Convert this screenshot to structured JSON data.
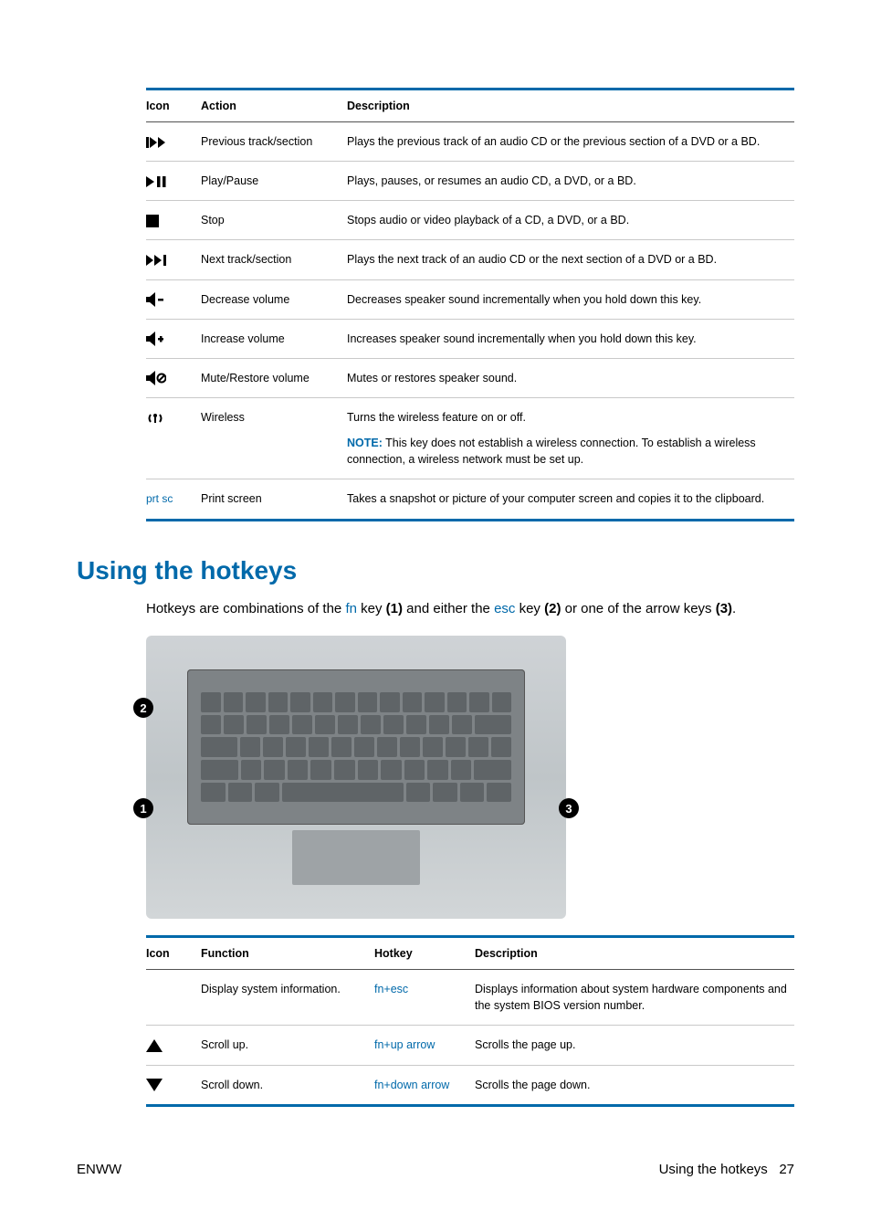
{
  "table1": {
    "headers": {
      "icon": "Icon",
      "action": "Action",
      "desc": "Description"
    },
    "rows": [
      {
        "action": "Previous track/section",
        "desc": "Plays the previous track of an audio CD or the previous section of a DVD or a BD."
      },
      {
        "action": "Play/Pause",
        "desc": "Plays, pauses, or resumes an audio CD, a DVD, or a BD."
      },
      {
        "action": "Stop",
        "desc": "Stops audio or video playback of a CD, a DVD, or a BD."
      },
      {
        "action": "Next track/section",
        "desc": "Plays the next track of an audio CD or the next section of a DVD or a BD."
      },
      {
        "action": "Decrease volume",
        "desc": "Decreases speaker sound incrementally when you hold down this key."
      },
      {
        "action": "Increase volume",
        "desc": "Increases speaker sound incrementally when you hold down this key."
      },
      {
        "action": "Mute/Restore volume",
        "desc": "Mutes or restores speaker sound."
      },
      {
        "action": "Wireless",
        "desc": "Turns the wireless feature on or off.",
        "note_label": "NOTE:",
        "note": " This key does not establish a wireless connection. To establish a wireless connection, a wireless network must be set up."
      },
      {
        "icon_text": "prt sc",
        "action": "Print screen",
        "desc": "Takes a snapshot or picture of your computer screen and copies it to the clipboard."
      }
    ]
  },
  "section_heading": "Using the hotkeys",
  "intro": {
    "p1": "Hotkeys are combinations of the ",
    "fn": "fn",
    "p2": " key ",
    "b1": "(1)",
    "p3": " and either the ",
    "esc": "esc",
    "p4": " key ",
    "b2": "(2)",
    "p5": " or one of the arrow keys ",
    "b3": "(3)",
    "p6": "."
  },
  "callouts": {
    "n1": "1",
    "n2": "2",
    "n3": "3"
  },
  "table2": {
    "headers": {
      "icon": "Icon",
      "func": "Function",
      "hotkey": "Hotkey",
      "desc": "Description"
    },
    "rows": [
      {
        "func": "Display system information.",
        "hotkey": "fn+esc",
        "desc": "Displays information about system hardware components and the system BIOS version number."
      },
      {
        "func": "Scroll up.",
        "hotkey": "fn+up arrow",
        "desc": "Scrolls the page up."
      },
      {
        "func": "Scroll down.",
        "hotkey": "fn+down arrow",
        "desc": "Scrolls the page down."
      }
    ]
  },
  "footer": {
    "left": "ENWW",
    "right_text": "Using the hotkeys",
    "page": "27"
  }
}
